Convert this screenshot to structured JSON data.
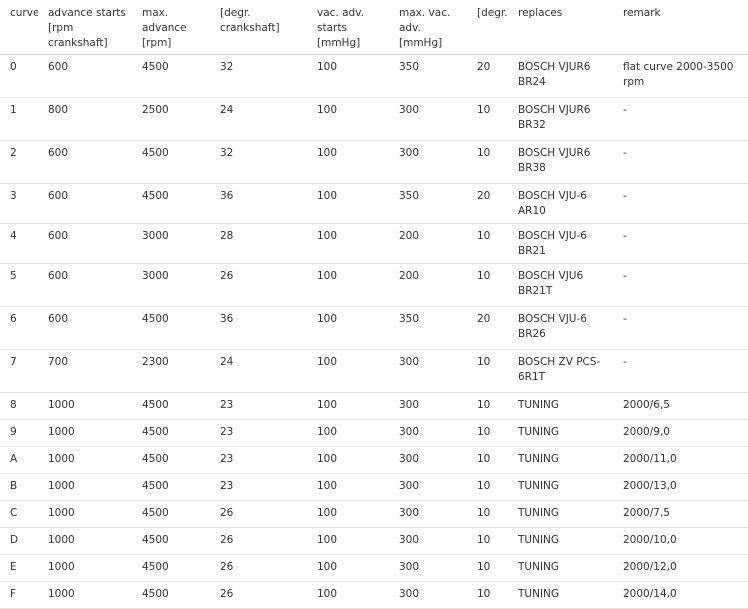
{
  "headers": [
    [
      "curve"
    ],
    [
      "advance starts",
      "[rpm",
      "crankshaft]"
    ],
    [
      "max.",
      "advance",
      "[rpm]"
    ],
    [
      "[degr.",
      "crankshaft]"
    ],
    [
      "vac. adv.",
      "starts",
      "[mmHg]"
    ],
    [
      "max. vac.",
      "adv.",
      "[mmHg]"
    ],
    [
      "[degr.]"
    ],
    [
      "replaces"
    ],
    [
      "remark"
    ]
  ],
  "rows": [
    [
      "0",
      "600",
      "4500",
      "32",
      "100",
      "350",
      "20",
      "BOSCH VJUR6 BR24",
      "flat curve 2000-3500 rpm"
    ],
    [
      "1",
      "800",
      "2500",
      "24",
      "100",
      "300",
      "10",
      "BOSCH VJUR6 BR32",
      "-"
    ],
    [
      "2",
      "600",
      "4500",
      "32",
      "100",
      "300",
      "10",
      "BOSCH VJUR6 BR38",
      "-"
    ],
    [
      "3",
      "600",
      "4500",
      "36",
      "100",
      "350",
      "20",
      "BOSCH VJU-6 AR10",
      "-"
    ],
    [
      "4",
      "600",
      "3000",
      "28",
      "100",
      "200",
      "10",
      "BOSCH VJU-6 BR21",
      "-"
    ],
    [
      "5",
      "600",
      "3000",
      "26",
      "100",
      "200",
      "10",
      "BOSCH VJU6 BR21T",
      "-"
    ],
    [
      "6",
      "600",
      "4500",
      "36",
      "100",
      "350",
      "20",
      "BOSCH VJU-6 BR26",
      "-"
    ],
    [
      "7",
      "700",
      "2300",
      "24",
      "100",
      "300",
      "10",
      "BOSCH ZV PCS-6R1T",
      "-"
    ],
    [
      "8",
      "1000",
      "4500",
      "23",
      "100",
      "300",
      "10",
      "TUNING",
      "2000/6,5"
    ],
    [
      "9",
      "1000",
      "4500",
      "23",
      "100",
      "300",
      "10",
      "TUNING",
      "2000/9,0"
    ],
    [
      "A",
      "1000",
      "4500",
      "23",
      "100",
      "300",
      "10",
      "TUNING",
      "2000/11,0"
    ],
    [
      "B",
      "1000",
      "4500",
      "23",
      "100",
      "300",
      "10",
      "TUNING",
      "2000/13,0"
    ],
    [
      "C",
      "1000",
      "4500",
      "26",
      "100",
      "300",
      "10",
      "TUNING",
      "2000/7,5"
    ],
    [
      "D",
      "1000",
      "4500",
      "26",
      "100",
      "300",
      "10",
      "TUNING",
      "2000/10,0"
    ],
    [
      "E",
      "1000",
      "4500",
      "26",
      "100",
      "300",
      "10",
      "TUNING",
      "2000/12,0"
    ],
    [
      "F",
      "1000",
      "4500",
      "26",
      "100",
      "300",
      "10",
      "TUNING",
      "2000/14,0"
    ]
  ],
  "colors": {
    "text": "#333333",
    "row_border": "#e3e3e3",
    "header_border": "#d4d4d4",
    "background": "#ffffff"
  }
}
